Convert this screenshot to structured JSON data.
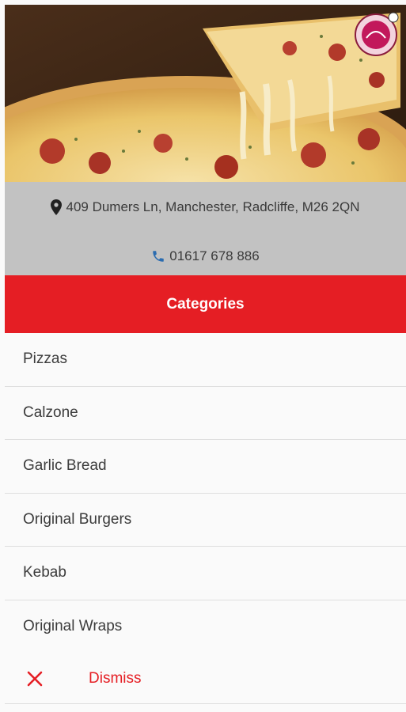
{
  "store": {
    "address": "409 Dumers Ln, Manchester, Radcliffe, M26 2QN",
    "phone": "01617 678 886",
    "address_icon": "map-marker-icon",
    "phone_icon": "phone-icon"
  },
  "hero": {
    "image": "pizza-slice-photo",
    "logo": "restaurant-logo"
  },
  "categories": {
    "title": "Categories",
    "items": [
      {
        "label": "Pizzas"
      },
      {
        "label": "Calzone"
      },
      {
        "label": "Garlic Bread"
      },
      {
        "label": "Original Burgers"
      },
      {
        "label": "Kebab"
      },
      {
        "label": "Original Wraps"
      }
    ]
  },
  "dismiss": {
    "label": "Dismiss",
    "icon": "close-icon"
  },
  "colors": {
    "accent": "#e51e24",
    "info_bg": "#c2c2c2",
    "phone_icon": "#2b6cb0"
  }
}
